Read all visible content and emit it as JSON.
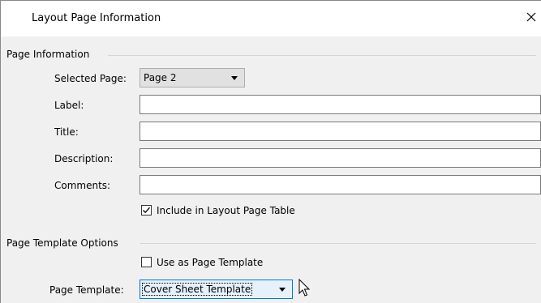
{
  "dialog": {
    "title": "Layout Page Information",
    "close_icon": "close-x-icon"
  },
  "page_information": {
    "group_label": "Page Information",
    "selected_page": {
      "label": "Selected Page:",
      "value": "Page 2"
    },
    "label_field": {
      "label": "Label:",
      "value": ""
    },
    "title_field": {
      "label": "Title:",
      "value": ""
    },
    "description_field": {
      "label": "Description:",
      "value": ""
    },
    "comments_field": {
      "label": "Comments:",
      "value": ""
    },
    "include_in_table": {
      "label": "Include in Layout Page Table",
      "checked": true
    }
  },
  "page_template_options": {
    "group_label": "Page Template Options",
    "use_as_template": {
      "label": "Use as Page Template",
      "checked": false
    },
    "page_template": {
      "label": "Page Template:",
      "value": "Cover Sheet Template"
    }
  },
  "icons": {
    "dropdown": "chevron-down-icon",
    "checkmark": "checkmark-icon",
    "cursor": "mouse-pointer-icon"
  }
}
